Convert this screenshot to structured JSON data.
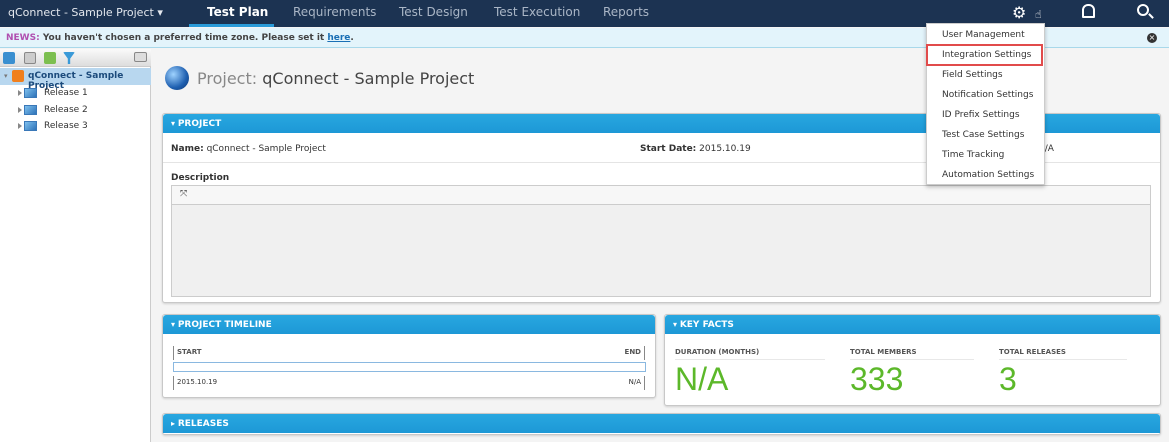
{
  "topnav": {
    "project_selector": "qConnect - Sample Project",
    "tabs": [
      "Test Plan",
      "Requirements",
      "Test Design",
      "Test Execution",
      "Reports"
    ],
    "active_tab": "Test Plan"
  },
  "news": {
    "label": "NEWS:",
    "text": "You haven't chosen a preferred time zone. Please set it ",
    "link": "here",
    "end": "."
  },
  "tree": {
    "root": "qConnect - Sample Project",
    "items": [
      "Release 1",
      "Release 2",
      "Release 3"
    ]
  },
  "page": {
    "title_key": "Project:",
    "title_value": "qConnect - Sample Project"
  },
  "project": {
    "header": "PROJECT",
    "name_label": "Name:",
    "name": "qConnect - Sample Project",
    "start_label": "Start Date:",
    "start": "2015.10.19",
    "end": "N/A",
    "description_label": "Description"
  },
  "timeline": {
    "header": "PROJECT TIMELINE",
    "start_label": "START",
    "end_label": "END",
    "start": "2015.10.19",
    "end": "N/A"
  },
  "key_facts": {
    "header": "KEY FACTS",
    "duration_label": "DURATION (MONTHS)",
    "duration": "N/A",
    "members_label": "TOTAL MEMBERS",
    "members": "333",
    "releases_label": "TOTAL RELEASES",
    "releases": "3"
  },
  "releases": {
    "header": "RELEASES"
  },
  "settings_menu": {
    "items": [
      "User Management",
      "Integration Settings",
      "Field Settings",
      "Notification Settings",
      "ID Prefix Settings",
      "Test Case Settings",
      "Time Tracking",
      "Automation Settings"
    ],
    "highlighted": "Integration Settings"
  },
  "colors": {
    "nav": "#1c3352",
    "panel_header": "#1d98d6",
    "value_green": "#5cb82a",
    "highlight": "#e14b4b"
  }
}
